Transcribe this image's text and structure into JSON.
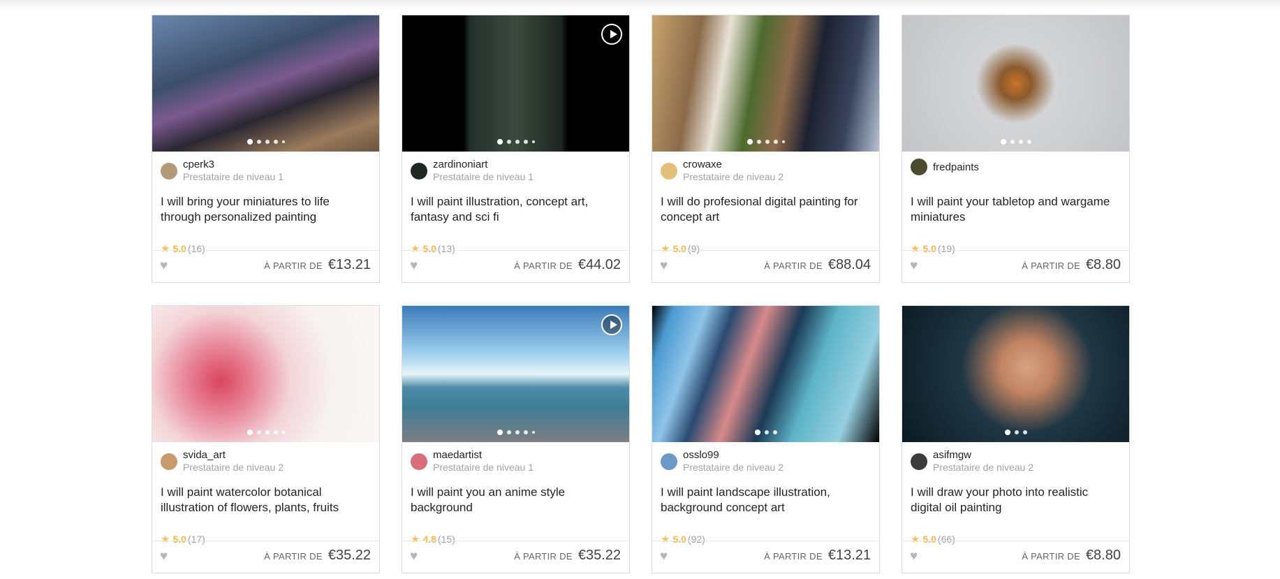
{
  "price_label": "À PARTIR DE",
  "cards": [
    {
      "seller": "cperk3",
      "level": "Prestataire de niveau 1",
      "title": "I will bring your miniatures to life through personalized painting",
      "rating": "5.0",
      "reviews": "(16)",
      "price": "€13.21",
      "dots": 5,
      "video": false,
      "image": "miniature dragon figure",
      "avatar_color": "#b59a7a",
      "bg": "linear-gradient(160deg,#6a86ad 0%,#3c4f6b 35%,#7b5a8f 50%,#2a2731 65%,#9a7b5c 85%,#6b5440 100%)"
    },
    {
      "seller": "zardinoniart",
      "level": "Prestataire de niveau 1",
      "title": "I will paint illustration, concept art, fantasy and sci fi",
      "rating": "5.0",
      "reviews": "(13)",
      "price": "€44.02",
      "dots": 5,
      "video": true,
      "image": "dark fantasy character illustration",
      "avatar_color": "#1f2722",
      "bg": "linear-gradient(90deg,#000 0%,#000 27%,#25302c 30%,#3b4a3f 50%,#1d2620 70%,#000 73%,#000 100%)"
    },
    {
      "seller": "crowaxe",
      "level": "Prestataire de niveau 2",
      "title": "I will do profesional digital painting for concept art",
      "rating": "5.0",
      "reviews": "(9)",
      "price": "€88.04",
      "dots": 5,
      "video": false,
      "image": "superhero digital paintings",
      "avatar_color": "#e2c07c",
      "bg": "linear-gradient(100deg,#c8a46e 0%,#8a6a4a 20%,#e8e2d6 32%,#4d6b2f 45%,#8d6a4c 58%,#1d2230 70%,#39435d 85%,#b8c2d4 100%)"
    },
    {
      "seller": "fredpaints",
      "level": "",
      "title": "I will paint your tabletop and wargame miniatures",
      "rating": "5.0",
      "reviews": "(19)",
      "price": "€8.80",
      "dots": 4,
      "video": false,
      "image": "orange wargame miniatures",
      "avatar_color": "#4b4a2c",
      "bg": "radial-gradient(circle at 50% 50%,#c9742a 0%,#8a5a2c 12%,#d3d4d6 30%,#c4c5c8 100%)"
    },
    {
      "seller": "svida_art",
      "level": "Prestataire de niveau 2",
      "title": "I will paint watercolor botanical illustration of flowers, plants, fruits",
      "rating": "5.0",
      "reviews": "(17)",
      "price": "€35.22",
      "dots": 5,
      "video": false,
      "image": "watercolor peony",
      "avatar_color": "#c99a6b",
      "bg": "radial-gradient(circle at 30% 55%,#d9455d 0%,#e8879a 20%,#f3d4d9 40%,#f7f3f1 65%,#faf7f5 100%)"
    },
    {
      "seller": "maedartist",
      "level": "Prestataire de niveau 1",
      "title": "I will paint you an anime style background",
      "rating": "4.8",
      "reviews": "(15)",
      "price": "€35.22",
      "dots": 5,
      "video": true,
      "image": "anime seaside background",
      "avatar_color": "#d66f7a",
      "bg": "linear-gradient(180deg,#3a7bb8 0%,#9fd0ef 35%,#e8f4f9 50%,#4d8ca8 60%,#3f7c96 75%,#7c7f83 100%)"
    },
    {
      "seller": "osslo99",
      "level": "Prestataire de niveau 2",
      "title": "I will paint landscape illustration, background concept art",
      "rating": "5.0",
      "reviews": "(92)",
      "price": "€13.21",
      "dots": 3,
      "video": false,
      "image": "landscape strips",
      "avatar_color": "#6b98c8",
      "bg": "linear-gradient(110deg,#000 0%,#4b9ad0 8%,#8fc4e8 20%,#2a4a70 30%,#d88a8a 42%,#1b3a55 55%,#5db4c8 68%,#95cfe0 85%,#000 100%)"
    },
    {
      "seller": "asifmgw",
      "level": "Prestataire de niveau 2",
      "title": "I will draw your photo into realistic digital oil painting",
      "rating": "5.0",
      "reviews": "(66)",
      "price": "€8.80",
      "dots": 3,
      "video": false,
      "image": "portrait of old man in hat",
      "avatar_color": "#3b3b3b",
      "bg": "radial-gradient(circle at 55% 45%,#d7a282 0%,#c28462 18%,#1f3644 45%,#0b1a22 100%)"
    }
  ]
}
